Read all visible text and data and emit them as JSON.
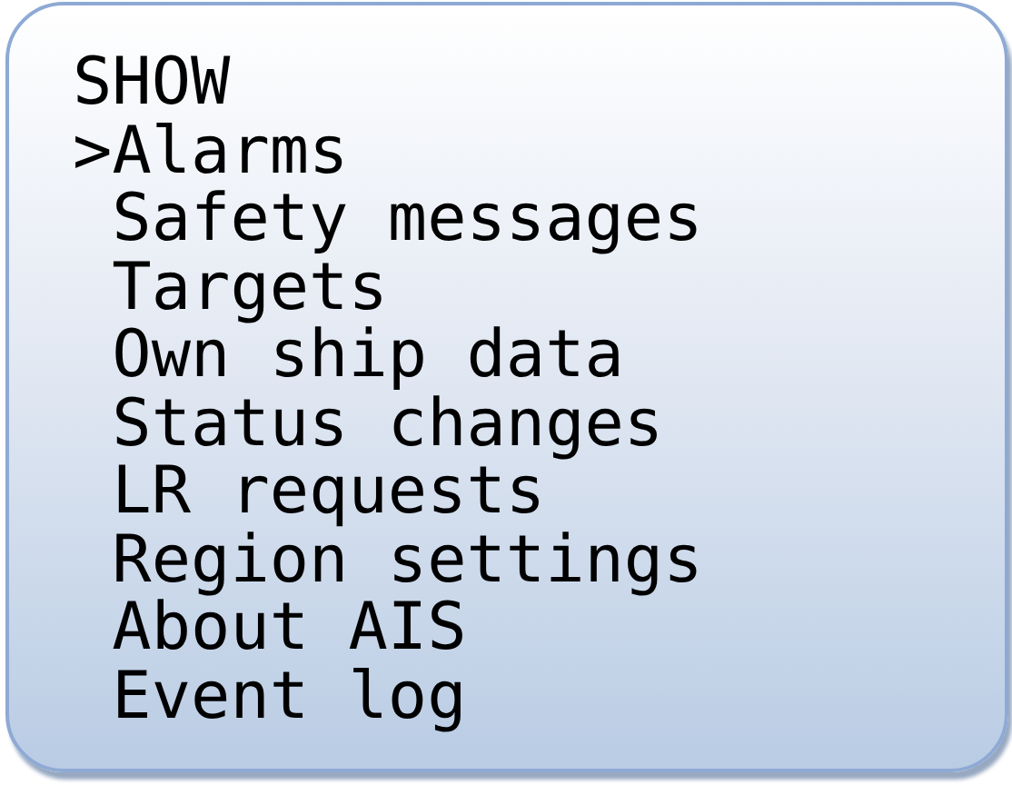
{
  "menu": {
    "title": "SHOW",
    "cursor": ">",
    "items": [
      {
        "label": "Alarms",
        "selected": true
      },
      {
        "label": "Safety messages",
        "selected": false
      },
      {
        "label": "Targets",
        "selected": false
      },
      {
        "label": "Own ship data",
        "selected": false
      },
      {
        "label": "Status changes",
        "selected": false
      },
      {
        "label": "LR requests",
        "selected": false
      },
      {
        "label": "Region settings",
        "selected": false
      },
      {
        "label": "About AIS",
        "selected": false
      },
      {
        "label": "Event log",
        "selected": false
      }
    ]
  }
}
